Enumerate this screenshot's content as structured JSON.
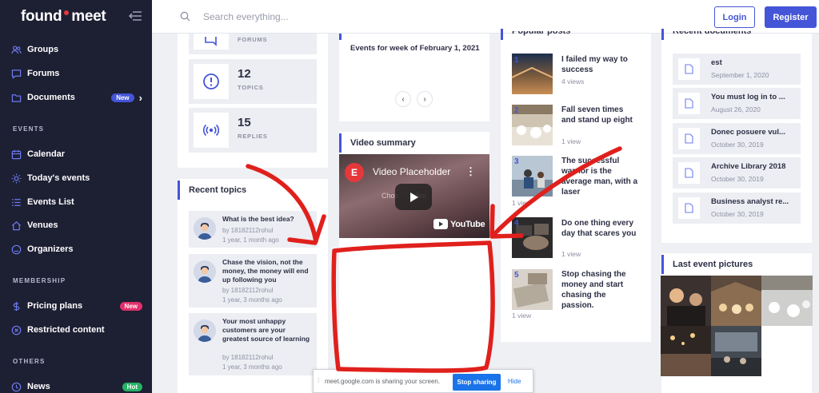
{
  "sidebar": {
    "logo_left": "found",
    "logo_right": "meet",
    "items": [
      {
        "label": "Groups",
        "icon": "users-icon"
      },
      {
        "label": "Forums",
        "icon": "chat-icon"
      },
      {
        "label": "Documents",
        "icon": "folder-icon",
        "badge": "New"
      },
      {
        "label": "Calendar",
        "icon": "calendar-icon"
      },
      {
        "label": "Today's events",
        "icon": "sun-icon"
      },
      {
        "label": "Events List",
        "icon": "list-icon"
      },
      {
        "label": "Venues",
        "icon": "home-icon"
      },
      {
        "label": "Organizers",
        "icon": "smile-icon"
      },
      {
        "label": "Pricing plans",
        "icon": "dollar-icon",
        "badge": "New"
      },
      {
        "label": "Restricted content",
        "icon": "block-icon"
      },
      {
        "label": "News",
        "icon": "news-icon",
        "badge": "Hot"
      }
    ],
    "sections": {
      "events": "EVENTS",
      "membership": "MEMBERSHIP",
      "others": "OTHERS"
    },
    "badge_colors": {
      "documents": "#4455d8",
      "pricing": "#e1306c",
      "news": "#27b064"
    }
  },
  "header": {
    "search_placeholder": "Search everything...",
    "login": "Login",
    "register": "Register"
  },
  "stats": [
    {
      "value": "",
      "label": "FORUMS"
    },
    {
      "value": "12",
      "label": "TOPICS"
    },
    {
      "value": "15",
      "label": "REPLIES"
    }
  ],
  "recent_topics": {
    "title": "Recent topics",
    "items": [
      {
        "title": "What is the best idea?",
        "author": "by 18182112rohul",
        "time": "1 year, 1 month ago"
      },
      {
        "title": "Chase the vision, not the money, the money will end up following you",
        "author": "by 18182112rohul",
        "time": "1 year, 3 months ago"
      },
      {
        "title": "Your most unhappy customers are your greatest source of learning",
        "author": "by 18182112rohul",
        "time": "1 year, 3 months ago"
      }
    ]
  },
  "events_card": {
    "text": "Events for week of February 1, 2021",
    "prev": "‹",
    "next": "›"
  },
  "video": {
    "title": "Video summary",
    "player_title": "Video Placeholder",
    "subtitle": "Choo       ideo",
    "brand": "YouTube"
  },
  "popular_posts": {
    "title": "Popular posts",
    "items": [
      {
        "num": "1",
        "title": "I failed my way to success",
        "views": "4 views"
      },
      {
        "num": "2",
        "title": "Fall seven times and stand up eight",
        "views": "1 view"
      },
      {
        "num": "3",
        "title": "The successful warrior is the average man, with a laser",
        "views": "1 view"
      },
      {
        "num": "4",
        "title": "Do one thing every day that scares you",
        "views": "1 view"
      },
      {
        "num": "5",
        "title": "Stop chasing the money and start chasing the passion.",
        "views": "1 view"
      }
    ]
  },
  "recent_documents": {
    "title": "Recent documents",
    "items": [
      {
        "title": "est",
        "date": "September 1, 2020"
      },
      {
        "title": "You must log in to ...",
        "date": "August 26, 2020"
      },
      {
        "title": "Donec posuere vul...",
        "date": "October 30, 2019"
      },
      {
        "title": "Archive Library 2018",
        "date": "October 30, 2019"
      },
      {
        "title": "Business analyst re...",
        "date": "October 30, 2019"
      }
    ]
  },
  "gallery": {
    "title": "Last event pictures"
  },
  "share_bar": {
    "text": "meet.google.com is sharing your screen.",
    "stop": "Stop sharing",
    "hide": "Hide"
  },
  "colors": {
    "accent": "#4455d8",
    "sidebar_bg": "#1d1f33",
    "annotation": "#e0201c"
  }
}
